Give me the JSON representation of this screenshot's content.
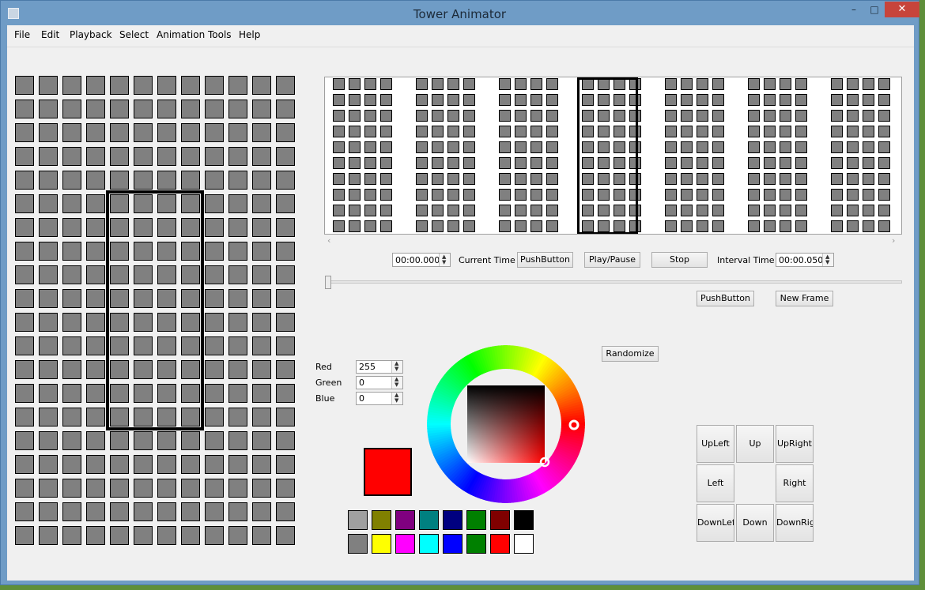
{
  "window": {
    "title": "Tower Animator",
    "minimize": "–",
    "maximize": "□",
    "close": "✕"
  },
  "menu": [
    "File",
    "Edit",
    "Playback",
    "Select",
    "Animation Tools",
    "Help"
  ],
  "main_grid": {
    "rows": 20,
    "cols": 12,
    "cell_color": "#808080",
    "selection": {
      "row_start": 5,
      "row_end": 14,
      "col_start": 4,
      "col_end": 7
    }
  },
  "frames": {
    "count": 7,
    "rows": 10,
    "cols": 4,
    "selected_index": 3,
    "cell_color": "#808080"
  },
  "timeline": {
    "current_time_value": "00:00.000",
    "current_time_label": "Current Time",
    "push_button_label": "PushButton",
    "play_pause_label": "Play/Pause",
    "stop_label": "Stop",
    "interval_time_label": "Interval Time",
    "interval_time_value": "00:00.050",
    "slider_position": 0
  },
  "frame_buttons": {
    "push_button_label": "PushButton",
    "new_frame_label": "New Frame"
  },
  "color": {
    "red_label": "Red",
    "red_value": "255",
    "green_label": "Green",
    "green_value": "0",
    "blue_label": "Blue",
    "blue_value": "0",
    "randomize_label": "Randomize",
    "current_color": "#ff0000"
  },
  "swatches": {
    "row1": [
      "#a0a0a0",
      "#808000",
      "#800080",
      "#008080",
      "#000080",
      "#008000",
      "#800000",
      "#000000"
    ],
    "row2": [
      "#808080",
      "#ffff00",
      "#ff00ff",
      "#00ffff",
      "#0000ff",
      "#008000",
      "#ff0000",
      "#ffffff"
    ]
  },
  "directions": {
    "upleft": "UpLeft",
    "up": "Up",
    "upright": "UpRight",
    "left": "Left",
    "right": "Right",
    "downleft": "DownLeft",
    "down": "Down",
    "downright": "DownRight"
  }
}
